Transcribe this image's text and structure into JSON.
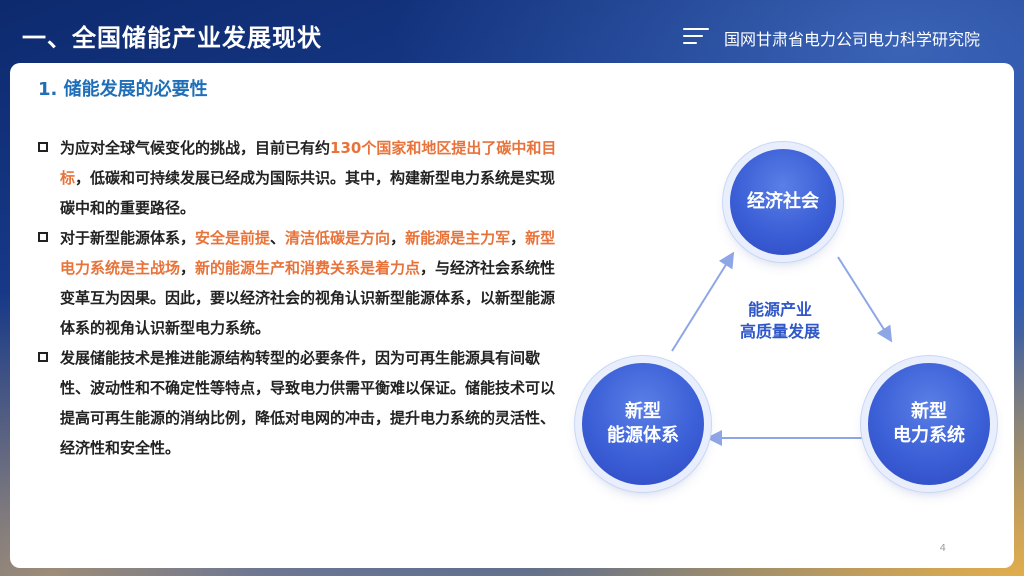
{
  "header": {
    "title": "一、全国储能产业发展现状",
    "org_name": "国网甘肃省电力公司电力科学研究院",
    "icons": [
      "menu-icon"
    ]
  },
  "section": {
    "title": "1. 储能发展的必要性"
  },
  "bullets": [
    {
      "segments": [
        {
          "text": "为应对全球气候变化的挑战，目前已有约",
          "hl": false
        },
        {
          "text": "130个国家和地区提出了碳中和目标",
          "hl": true
        },
        {
          "text": "，低碳和可持续发展已经成为国际共识。其中，构建新型电力系统是实现碳中和的重要路径。",
          "hl": false
        }
      ]
    },
    {
      "segments": [
        {
          "text": "对于新型能源体系，",
          "hl": false
        },
        {
          "text": "安全是前提",
          "hl": true
        },
        {
          "text": "、",
          "hl": false
        },
        {
          "text": "清洁低碳是方向",
          "hl": true
        },
        {
          "text": "，",
          "hl": false
        },
        {
          "text": "新能源是主力军",
          "hl": true
        },
        {
          "text": "，",
          "hl": false
        },
        {
          "text": "新型电力系统是主战场",
          "hl": true
        },
        {
          "text": "，",
          "hl": false
        },
        {
          "text": "新的能源生产和消费关系是着力点",
          "hl": true
        },
        {
          "text": "，与经济社会系统性变革互为因果。因此，要以经济社会的视角认识新型能源体系，以新型能源体系的视角认识新型电力系统。",
          "hl": false
        }
      ]
    },
    {
      "segments": [
        {
          "text": "发展储能技术是推进能源结构转型的必要条件，因为可再生能源具有间歇性、波动性和不确定性等特点，导致电力供需平衡难以保证。储能技术可以提高可再生能源的消纳比例，降低对电网的冲击，提升电力系统的灵活性、经济性和安全性。",
          "hl": false
        }
      ]
    }
  ],
  "diagram": {
    "top": "经济社会",
    "left_line1": "新型",
    "left_line2": "能源体系",
    "right_line1": "新型",
    "right_line2": "电力系统",
    "center_line1": "能源产业",
    "center_line2": "高质量发展"
  },
  "page_number": "4",
  "colors": {
    "highlight": "#e8733a",
    "title_blue": "#1f6fb8",
    "circle_blue": "#3b5fd6"
  }
}
